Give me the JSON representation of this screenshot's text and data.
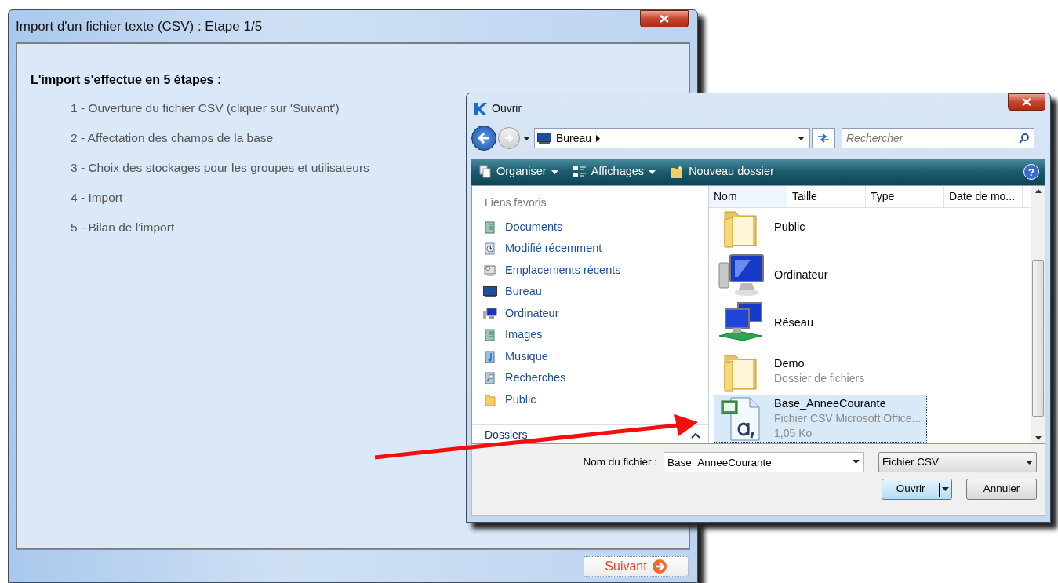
{
  "wizard": {
    "title": "Import d'un fichier texte (CSV) : Etape 1/5",
    "heading": "L'import s'effectue en 5 étapes :",
    "steps": [
      "1 - Ouverture du fichier CSV (cliquer sur 'Suivant')",
      "2 - Affectation des champs de la base",
      "3 - Choix des stockages pour les groupes et utilisateurs",
      "4 - Import",
      "5 - Bilan de l'import"
    ],
    "next_button": "Suivant"
  },
  "dialog": {
    "title": "Ouvrir",
    "path": "Bureau",
    "search": {
      "placeholder": "Rechercher"
    },
    "toolbar": [
      "Organiser",
      "Affichages",
      "Nouveau dossier"
    ],
    "help": "?",
    "favorites_title": "Liens favoris",
    "favorites": [
      {
        "label": "Documents",
        "kind": "doc"
      },
      {
        "label": "Modifié récemment",
        "kind": "recent"
      },
      {
        "label": "Emplacements récents",
        "kind": "places"
      },
      {
        "label": "Bureau",
        "kind": "desktop"
      },
      {
        "label": "Ordinateur",
        "kind": "computer"
      },
      {
        "label": "Images",
        "kind": "doc"
      },
      {
        "label": "Musique",
        "kind": "music"
      },
      {
        "label": "Recherches",
        "kind": "search"
      },
      {
        "label": "Public",
        "kind": "folder"
      }
    ],
    "folders_label": "Dossiers",
    "columns": [
      "Nom",
      "Taille",
      "Type",
      "Date de mo..."
    ],
    "files": [
      {
        "name": "Public",
        "kind": "folder",
        "selected": false
      },
      {
        "name": "Ordinateur",
        "kind": "computer",
        "selected": false
      },
      {
        "name": "Réseau",
        "kind": "network",
        "selected": false
      },
      {
        "name": "Demo",
        "kind": "folder",
        "details": [
          "Dossier de fichiers"
        ],
        "selected": false
      },
      {
        "name": "Base_AnneeCourante",
        "kind": "csv",
        "details": [
          "Fichier CSV Microsoft Office...",
          "1,05 Ko"
        ],
        "selected": true
      }
    ],
    "filename_label": "Nom du fichier :",
    "filename": "Base_AnneeCourante",
    "filetype": "Fichier CSV",
    "open_button": "Ouvrir",
    "cancel_button": "Annuler"
  }
}
